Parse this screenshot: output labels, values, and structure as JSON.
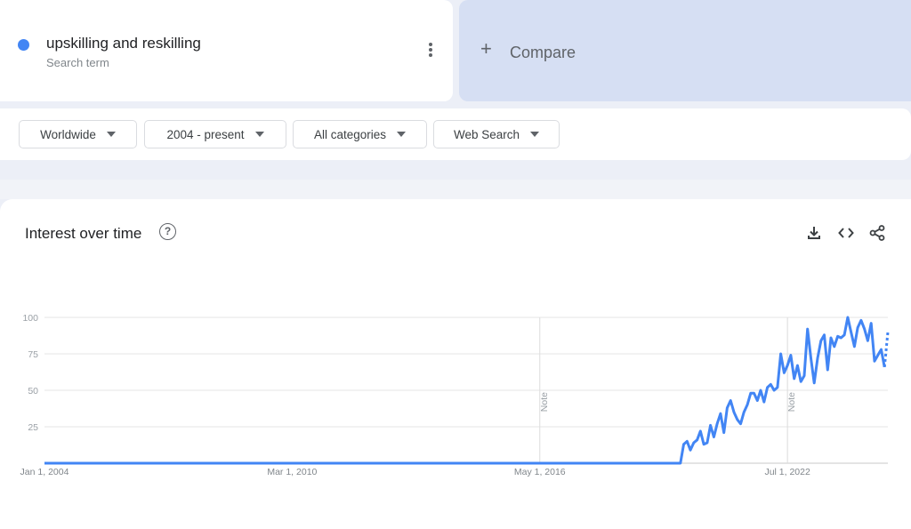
{
  "term": {
    "name": "upskilling and reskilling",
    "subtitle": "Search term",
    "color": "#4285f4"
  },
  "compare": {
    "plus": "+",
    "label": "Compare"
  },
  "filters": [
    {
      "label": "Worldwide"
    },
    {
      "label": "2004 - present"
    },
    {
      "label": "All categories"
    },
    {
      "label": "Web Search"
    }
  ],
  "chart_header": {
    "title": "Interest over time",
    "help": "?",
    "icons": [
      "download-icon",
      "embed-code-icon",
      "share-icon"
    ]
  },
  "chart_data": {
    "type": "line",
    "title": "Interest over time",
    "xlabel": "",
    "ylabel": "",
    "ylim": [
      0,
      100
    ],
    "yticks": [
      25,
      50,
      75,
      100
    ],
    "xtick_labels": [
      "Jan 1, 2004",
      "Mar 1, 2010",
      "May 1, 2016",
      "Jul 1, 2022"
    ],
    "xtick_months": [
      0,
      74,
      148,
      222
    ],
    "notes": [
      {
        "label": "Note",
        "month": 148
      },
      {
        "label": "Note",
        "month": 222
      }
    ],
    "grid": true,
    "legend": "none",
    "series": [
      {
        "name": "upskilling and reskilling",
        "color": "#4285f4",
        "start": "Jan 2004",
        "zero_months_until": 190,
        "values_from_month_190": [
          0,
          13,
          15,
          9,
          14,
          16,
          22,
          13,
          14,
          26,
          18,
          27,
          34,
          21,
          38,
          43,
          35,
          30,
          27,
          35,
          40,
          48,
          48,
          43,
          50,
          42,
          52,
          54,
          50,
          52,
          75,
          62,
          67,
          74,
          58,
          67,
          56,
          60,
          92,
          72,
          55,
          72,
          84,
          88,
          64,
          86,
          80,
          87,
          86,
          88,
          100,
          90,
          80,
          93,
          98,
          92,
          84,
          96,
          70,
          74,
          78,
          66
        ],
        "partial_tail": [
          66,
          90
        ]
      }
    ]
  }
}
